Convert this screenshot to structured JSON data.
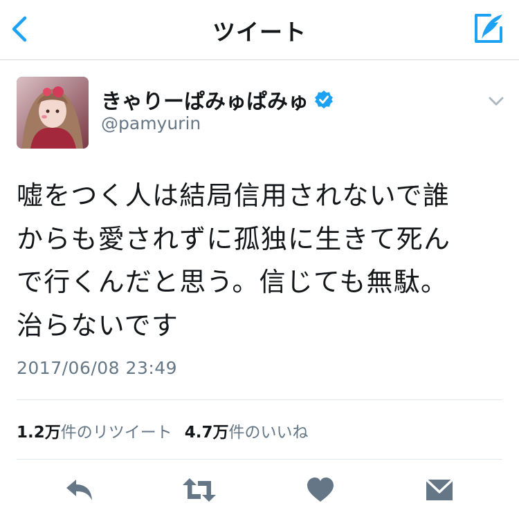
{
  "header": {
    "title": "ツイート"
  },
  "author": {
    "display_name": "きゃりーぱみゅぱみゅ",
    "handle": "@pamyurin",
    "verified": true
  },
  "tweet": {
    "text_lines": [
      "嘘をつく人は結局信用されないで誰",
      "からも愛されずに孤独に生きて死ん",
      "で行くんだと思う。信じても無駄。",
      "治らないです"
    ],
    "timestamp": "2017/06/08 23:49"
  },
  "stats": {
    "retweets_value": "1.2万",
    "retweets_label": "件のリツイート",
    "likes_value": "4.7万",
    "likes_label": "件のいいね"
  },
  "colors": {
    "text": "#14171a",
    "secondary": "#657786",
    "accent": "#1da1f2",
    "icon_gray": "#657786",
    "divider": "#e1e8ed"
  },
  "icons": {
    "back": "chevron-left-icon",
    "compose": "compose-quill-icon",
    "verified": "verified-badge-icon",
    "caret": "chevron-down-icon",
    "reply": "reply-icon",
    "retweet": "retweet-icon",
    "like": "heart-icon",
    "dm": "envelope-icon"
  }
}
